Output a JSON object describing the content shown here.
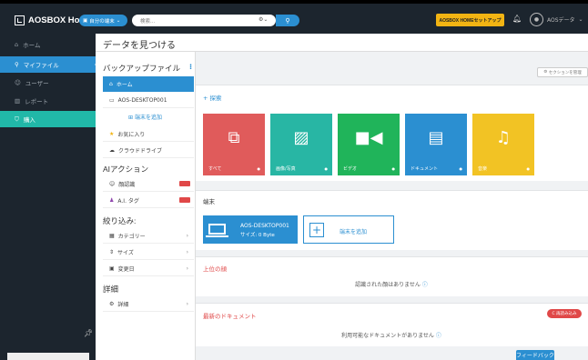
{
  "app": {
    "title": "AOSBOX Home",
    "device_pill": "自分の端末"
  },
  "search": {
    "placeholder": "検索..."
  },
  "header": {
    "setup_button": "AOSBOX HOMEセットアップ",
    "user_name": "AOSデータ"
  },
  "sidebar": {
    "items": [
      {
        "label": "ホーム",
        "icon": "home-icon"
      },
      {
        "label": "マイファイル",
        "icon": "search-icon"
      },
      {
        "label": "ユーザー",
        "icon": "users-icon"
      },
      {
        "label": "レポート",
        "icon": "chart-icon"
      },
      {
        "label": "購入",
        "icon": "cart-icon"
      }
    ]
  },
  "page": {
    "title": "データを見つける"
  },
  "panel": {
    "backup_heading": "バックアップファイル",
    "home": "ホーム",
    "device": "AOS-DESKTOP001",
    "add_device": "端末を追加",
    "favorites": "お気に入り",
    "cloud": "クラウドドライブ",
    "ai_heading": "AIアクション",
    "face": "顔認識",
    "ai_tag": "A.I. タグ",
    "filter_heading": "絞り込み:",
    "category": "カテゴリー",
    "size": "サイズ",
    "modified": "変更日",
    "details_heading": "詳細",
    "details": "詳細"
  },
  "main": {
    "section_mgmt": "セクションを管理",
    "explore_heading": "探索",
    "tiles": [
      {
        "label": "すべて",
        "color": "#e05b5b"
      },
      {
        "label": "画像/写真",
        "color": "#28b6a4"
      },
      {
        "label": "ビデオ",
        "color": "#20b45a"
      },
      {
        "label": "ドキュメント",
        "color": "#2b8fd1"
      },
      {
        "label": "音楽",
        "color": "#f2c324"
      }
    ],
    "devices_heading": "端末",
    "device_name": "AOS-DESKTOP001",
    "device_size": "サイズ: 0 Byte",
    "add_device": "端末を追加",
    "faces_heading": "上位の顔",
    "faces_empty": "認識された顔はありません",
    "docs_heading": "最新のドキュメント",
    "reload": "C 再読み込み",
    "docs_empty": "利用可能なドキュメントがありません",
    "feedback": "フィードバック"
  }
}
